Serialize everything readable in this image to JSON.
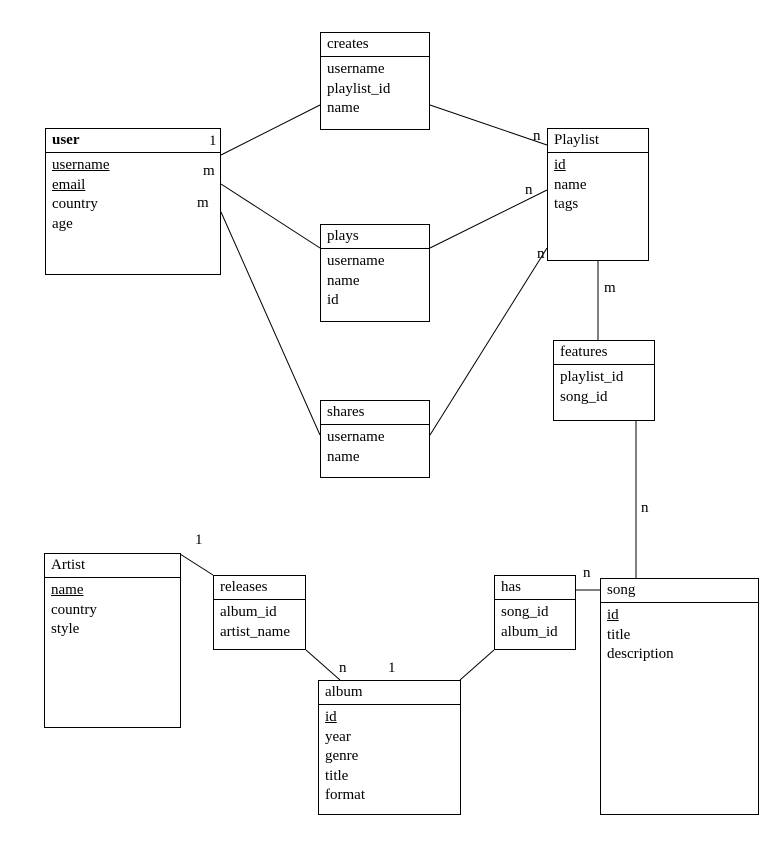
{
  "entities": {
    "user": {
      "title": "user",
      "bold": true,
      "attrs": [
        {
          "name": "username",
          "key": true
        },
        {
          "name": "email",
          "key": true
        },
        {
          "name": "country",
          "key": false
        },
        {
          "name": "age",
          "key": false
        }
      ]
    },
    "creates": {
      "title": "creates",
      "bold": false,
      "attrs": [
        {
          "name": "username",
          "key": false
        },
        {
          "name": "playlist_id",
          "key": false
        },
        {
          "name": "name",
          "key": false
        }
      ]
    },
    "playlist": {
      "title": "Playlist",
      "bold": false,
      "attrs": [
        {
          "name": "id",
          "key": true
        },
        {
          "name": "name",
          "key": false
        },
        {
          "name": "tags",
          "key": false
        }
      ]
    },
    "plays": {
      "title": "plays",
      "bold": false,
      "attrs": [
        {
          "name": "username",
          "key": false
        },
        {
          "name": "name",
          "key": false
        },
        {
          "name": "id",
          "key": false
        }
      ]
    },
    "shares": {
      "title": "shares",
      "bold": false,
      "attrs": [
        {
          "name": "username",
          "key": false
        },
        {
          "name": "name",
          "key": false
        }
      ]
    },
    "features": {
      "title": "features",
      "bold": false,
      "attrs": [
        {
          "name": "playlist_id",
          "key": false
        },
        {
          "name": "song_id",
          "key": false
        }
      ]
    },
    "artist": {
      "title": "Artist",
      "bold": false,
      "attrs": [
        {
          "name": "name",
          "key": true
        },
        {
          "name": "country",
          "key": false
        },
        {
          "name": "style",
          "key": false
        }
      ]
    },
    "releases": {
      "title": "releases",
      "bold": false,
      "attrs": [
        {
          "name": "album_id",
          "key": false
        },
        {
          "name": "artist_name",
          "key": false
        }
      ]
    },
    "album": {
      "title": "album",
      "bold": false,
      "attrs": [
        {
          "name": "id",
          "key": true
        },
        {
          "name": "year",
          "key": false
        },
        {
          "name": "genre",
          "key": false
        },
        {
          "name": "title",
          "key": false
        },
        {
          "name": "format",
          "key": false
        }
      ]
    },
    "has": {
      "title": "has",
      "bold": false,
      "attrs": [
        {
          "name": "song_id",
          "key": false
        },
        {
          "name": "album_id",
          "key": false
        }
      ]
    },
    "song": {
      "title": "song",
      "bold": false,
      "attrs": [
        {
          "name": "id",
          "key": true
        },
        {
          "name": "title",
          "key": false
        },
        {
          "name": "description",
          "key": false
        }
      ]
    }
  },
  "cardinalities": {
    "user_creates": "1",
    "user_plays": "m",
    "user_shares": "m",
    "creates_playlist": "n",
    "plays_playlist": "n",
    "shares_playlist": "n",
    "playlist_features": "m",
    "features_song": "n",
    "song_has": "n",
    "has_album": "1",
    "album_releases": "n",
    "releases_artist": "1"
  }
}
